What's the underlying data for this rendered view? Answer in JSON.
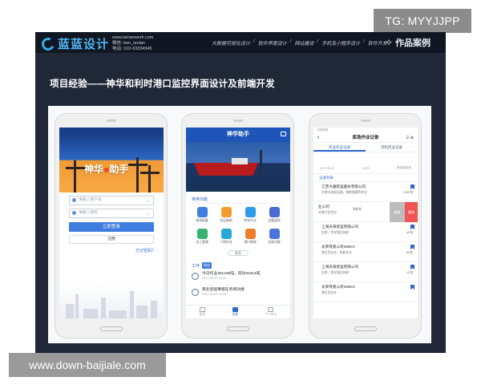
{
  "watermarks": {
    "top_right": "TG: MYYJJPP",
    "bottom_left": "www.down-baijiale.com"
  },
  "header": {
    "brand": "蓝蓝设计",
    "site": "www.lanlanwork.com",
    "qq": "微信: ben_lanlan",
    "phone": "电话: 010-63334945",
    "nav_items": [
      "大数据可视化设计",
      "软件界面设计",
      "网站建设",
      "手机及小程序设计",
      "软件开发"
    ],
    "case_label": "作品案例"
  },
  "page": {
    "project_title": "项目经验——神华和利时港口监控界面设计及前端开发"
  },
  "phone1": {
    "banner_title_left": "神华",
    "banner_title_right": "助手",
    "username_placeholder": "请输入用户名",
    "password_placeholder": "请输入密码",
    "login_button": "立即登录",
    "register_button": "注册",
    "forgot_link": "忘记密码?"
  },
  "phone2": {
    "header_title": "神华助手",
    "section_title": "常用功能",
    "functions": [
      "现场报备",
      "货运装卸",
      "库存作业",
      "设备监控",
      "员工管理",
      "门机作业",
      "港口物流",
      "全部功能"
    ],
    "more_button": "更多",
    "tasks_label": "工作",
    "tasks_badge": "待办",
    "tasks": [
      {
        "title": "今日作业451235吨，同比02314吨",
        "time": "2017-06-20 10:00"
      },
      {
        "title": "南北装船审核任务待对接",
        "time": "2017-06-20 09:30"
      }
    ],
    "tab_items": [
      "首页",
      "消息",
      "个人中心"
    ]
  },
  "phone3": {
    "status": "中国联通",
    "header_title": "库场作业记录",
    "tabs": [
      "作业作业记录",
      "货机作业记录"
    ],
    "date": "2017-06-20",
    "time": "16:00",
    "berth": "第四装卸组",
    "record_label": "记录列表",
    "records": [
      {
        "company": "江苏大通航运股份有限公司",
        "detail": "对港口装卸运输，钢铁锻模等作业",
        "qty": "1500吨"
      },
      {
        "company": "上海天海货运有限公司",
        "detail": "出库，库存钢品装卸",
        "qty": "40吨"
      },
      {
        "company": "长荣有限公司SINKO",
        "detail": "港区货运车，装卸作业",
        "qty": "60吨"
      },
      {
        "company": "上海天海货运有限公司",
        "detail": "出库，库存钢品装卸",
        "qty": "12吨"
      },
      {
        "company": "长荣有限公司SINKO",
        "detail": "港区货运车",
        "qty": ""
      }
    ],
    "swipe_row": {
      "company": "业公司",
      "detail": "对港大型货站",
      "mid": "装卸车",
      "action_edit": "编辑",
      "action_delete": "删除"
    }
  }
}
